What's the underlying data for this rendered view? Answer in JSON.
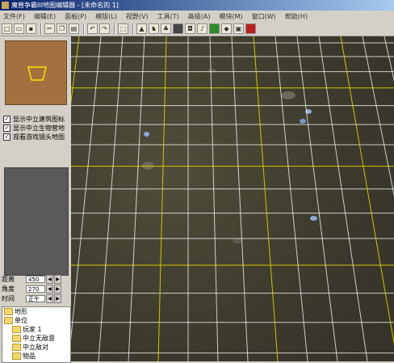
{
  "window": {
    "title": "魔兽争霸III地图编辑器 - [未命名的 1]"
  },
  "menu": [
    "文件(F)",
    "编辑(E)",
    "面板(P)",
    "模版(L)",
    "视野(V)",
    "工具(T)",
    "高级(A)",
    "模块(M)",
    "窗口(W)",
    "帮助(H)"
  ],
  "toolbar": {
    "icons": [
      "new-file-icon",
      "open-folder-icon",
      "save-icon",
      "cut-icon",
      "copy-icon",
      "paste-icon",
      "undo-icon",
      "redo-icon",
      "select-icon",
      "terrain-icon",
      "unit-icon",
      "doodad-icon",
      "region-icon",
      "camera-icon",
      "sound-icon",
      "trigger-icon",
      "object-icon",
      "test-map-icon"
    ]
  },
  "checkboxes": [
    {
      "label": "显示中立建筑图标",
      "checked": true
    },
    {
      "label": "显示中立生物营地",
      "checked": true
    },
    {
      "label": "观看游戏镜头地图",
      "checked": true
    }
  ],
  "camera": {
    "distance_label": "距离",
    "distance_value": "450",
    "angle_label": "角度",
    "angle_value": "270",
    "time_label": "时间",
    "time_value": "正午"
  },
  "tree": {
    "items": [
      {
        "label": "地形",
        "indent": 0
      },
      {
        "label": "单位",
        "indent": 0
      },
      {
        "label": "玩家 1",
        "indent": 1
      },
      {
        "label": "中立无敌意",
        "indent": 1
      },
      {
        "label": "中立敌对",
        "indent": 1
      },
      {
        "label": "物品",
        "indent": 1
      }
    ]
  },
  "colors": {
    "grid_line": "#ffffff",
    "grid_major": "#e0d000",
    "minimap_terrain": "#a57040",
    "camera_marker": "#ffe000"
  }
}
